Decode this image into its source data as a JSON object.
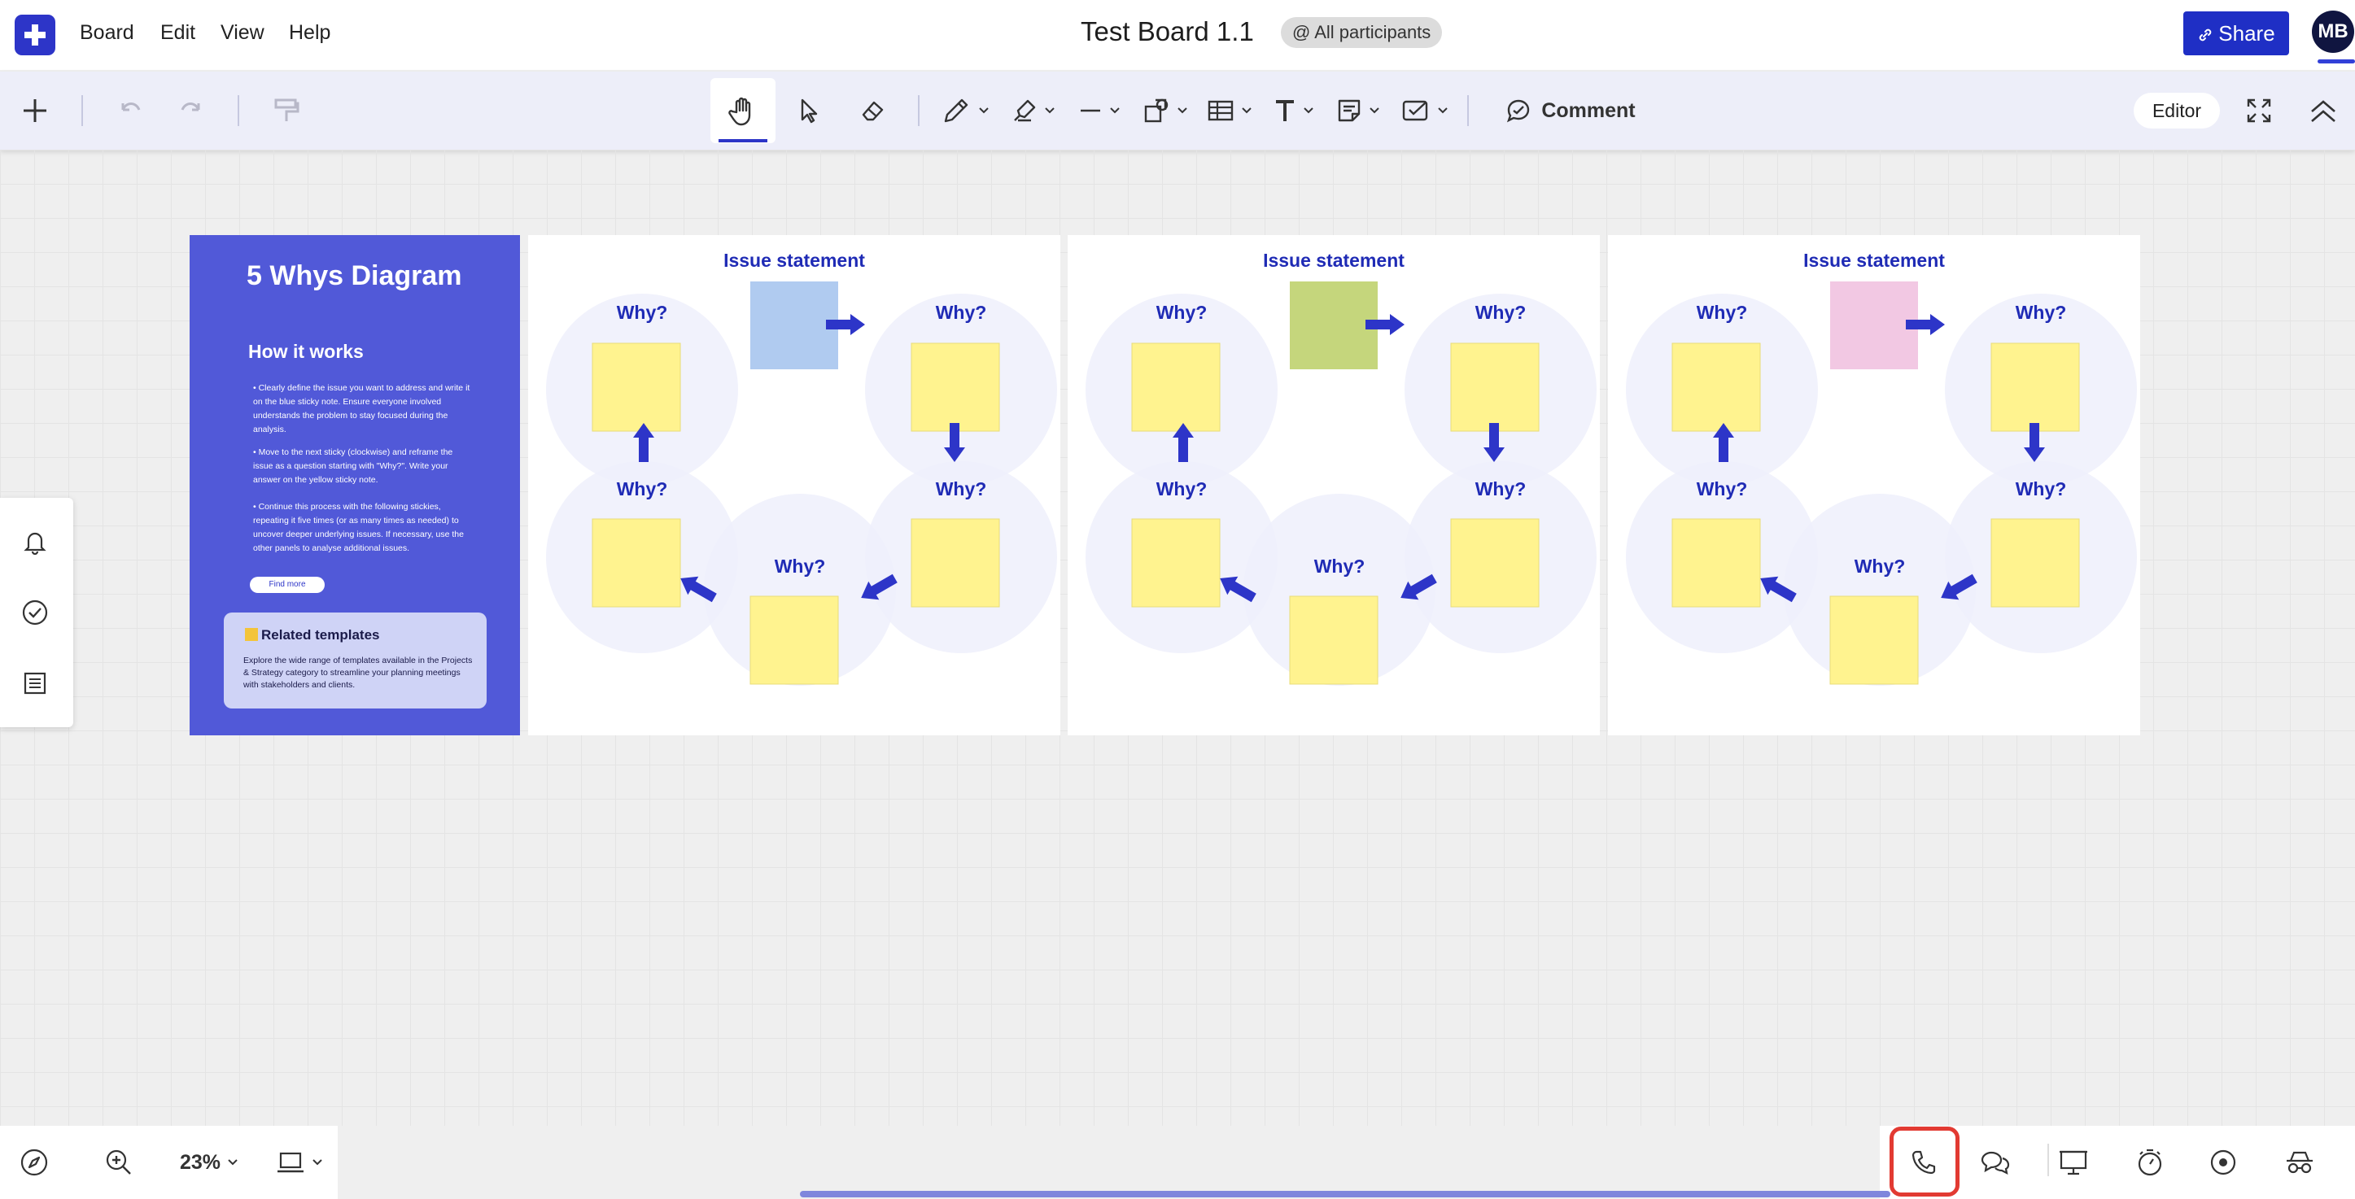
{
  "app": {
    "menu": [
      "Board",
      "Edit",
      "View",
      "Help"
    ],
    "title": "Test Board 1.1",
    "participants": "@ All participants",
    "share_label": "Share",
    "avatar_initials": "MB",
    "accent": "#2d35c8"
  },
  "toolbar": {
    "tools": [
      "plus-icon",
      "undo-icon",
      "redo-icon",
      "format-painter-icon",
      "hand-icon",
      "pointer-icon",
      "eraser-icon",
      "pen-icon",
      "highlighter-icon",
      "line-icon",
      "shapes-icon",
      "table-icon",
      "text-icon",
      "sticky-note-icon",
      "checkbox-icon"
    ],
    "active_tool": "hand-icon",
    "comment_label": "Comment",
    "editor_label": "Editor"
  },
  "info_panel": {
    "title": "5 Whys Diagram",
    "subtitle": "How it works",
    "steps": [
      "• Clearly define the issue you want to address and write it on the blue sticky note. Ensure everyone involved understands the problem to stay focused during the analysis.",
      "• Move to the next sticky (clockwise) and reframe the issue as a question starting with \"Why?\". Write your answer on the yellow sticky note.",
      "• Continue this process with the following stickies, repeating it five times (or as many times as needed) to uncover deeper underlying issues. If necessary, use the other panels to analyse additional issues."
    ],
    "find_more": "Find more",
    "related_title": "Related templates",
    "related_text": "Explore the wide range of templates available in the Projects & Strategy category to streamline your planning meetings with stakeholders and clients."
  },
  "panels": [
    {
      "issue_label": "Issue statement",
      "why_label": "Why?",
      "issue_color": "#b0cbf0"
    },
    {
      "issue_label": "Issue statement",
      "why_label": "Why?",
      "issue_color": "#c5d67c"
    },
    {
      "issue_label": "Issue statement",
      "why_label": "Why?",
      "issue_color": "#f2c8e3"
    }
  ],
  "colors": {
    "sticky_yellow": "#fff38f",
    "circle": "#eef0fb",
    "arrow": "#2d35c8"
  },
  "left_rail": [
    "bell-icon",
    "check-circle-icon",
    "list-icon"
  ],
  "bottom": {
    "zoom": "23%",
    "left_tools": [
      "compass-icon",
      "zoom-in-icon",
      "zoom-level",
      "device-icon"
    ],
    "right_tools": [
      "phone-icon",
      "chat-icon",
      "presentation-icon",
      "timer-icon",
      "record-icon",
      "incognito-icon"
    ],
    "highlighted": "phone-icon"
  }
}
